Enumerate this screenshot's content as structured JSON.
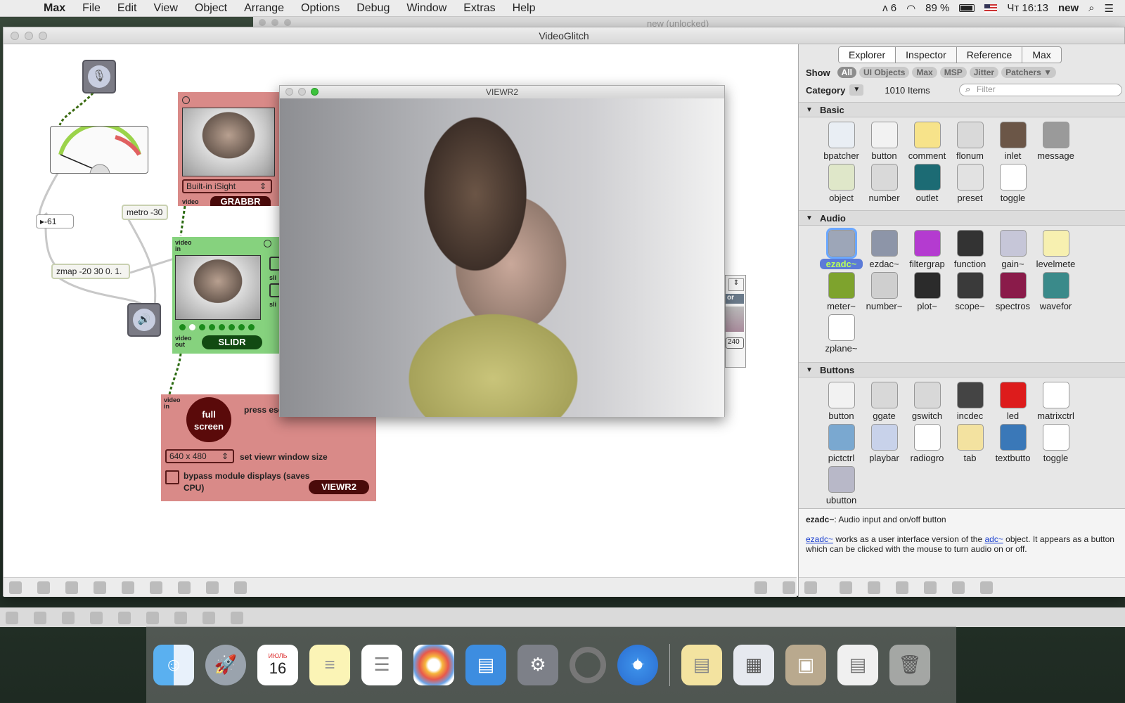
{
  "menubar": {
    "apple": "",
    "items": [
      "Max",
      "File",
      "Edit",
      "View",
      "Object",
      "Arrange",
      "Options",
      "Debug",
      "Window",
      "Extras",
      "Help"
    ],
    "status_input": "6",
    "battery": "89 %",
    "clock": "Чт 16:13",
    "user": "new"
  },
  "back_window": {
    "title": "new (unlocked)"
  },
  "main_window": {
    "title": "VideoGlitch"
  },
  "patcher": {
    "number_box": "-61",
    "metro": "metro -30",
    "zmap": "zmap -20 30 0. 1.",
    "grabbr": {
      "camera": "Built-in iSight",
      "tag": "video",
      "name": "GRABBR"
    },
    "slidr": {
      "in_tag": "video in",
      "out_tag": "video out",
      "name": "SLIDR",
      "slider1": "sli",
      "slider2": "sli"
    },
    "viewr": {
      "in_tag": "video in",
      "fullscreen_button": "full screen",
      "esc_note": "press esc to exit fullscreen",
      "size_value": "640 x 480",
      "size_label": "set viewr window size",
      "bypass_label": "bypass module displays (saves CPU)",
      "name": "VIEWR2"
    },
    "hidden_module": {
      "tag": "or",
      "value": "240"
    }
  },
  "viewr_window": {
    "title": "VIEWR2"
  },
  "panel": {
    "tabs": [
      "Explorer",
      "Inspector",
      "Reference",
      "Max"
    ],
    "show_label": "Show",
    "filters": [
      "All",
      "UI Objects",
      "Max",
      "MSP",
      "Jitter",
      "Patchers ▼"
    ],
    "category_label": "Category",
    "item_count": "1010 Items",
    "filter_placeholder": "Filter",
    "sections": {
      "basic": {
        "title": "Basic",
        "items": [
          {
            "label": "bpatcher",
            "icon": "bpatcher-icon",
            "color": "#e9eef4"
          },
          {
            "label": "button",
            "icon": "button-icon",
            "color": "#f2f2f2"
          },
          {
            "label": "comment",
            "icon": "comment-icon",
            "color": "#f7e38a"
          },
          {
            "label": "flonum",
            "icon": "flonum-icon",
            "color": "#d9d9d9"
          },
          {
            "label": "inlet",
            "icon": "inlet-icon",
            "color": "#6b5647"
          },
          {
            "label": "message",
            "icon": "message-icon",
            "color": "#9a9a9a"
          },
          {
            "label": "object",
            "icon": "object-icon",
            "color": "#dfe7c9"
          },
          {
            "label": "number",
            "icon": "number-icon",
            "color": "#d9d9d9"
          },
          {
            "label": "outlet",
            "icon": "outlet-icon",
            "color": "#1c6b74"
          },
          {
            "label": "preset",
            "icon": "preset-icon",
            "color": "#e2e2e2"
          },
          {
            "label": "toggle",
            "icon": "toggle-icon",
            "color": "#ffffff"
          }
        ]
      },
      "audio": {
        "title": "Audio",
        "items": [
          {
            "label": "ezadc~",
            "icon": "microphone-icon",
            "color": "#9da6b8"
          },
          {
            "label": "ezdac~",
            "icon": "speaker-icon",
            "color": "#8d95a8"
          },
          {
            "label": "filtergrap",
            "icon": "filtergraph-icon",
            "color": "#b43bd0"
          },
          {
            "label": "function",
            "icon": "function-icon",
            "color": "#333333"
          },
          {
            "label": "gain~",
            "icon": "gain-icon",
            "color": "#c6c6d8"
          },
          {
            "label": "levelmete",
            "icon": "levelmeter-icon",
            "color": "#f7f0b0"
          },
          {
            "label": "meter~",
            "icon": "meter-icon",
            "color": "#7ea32d"
          },
          {
            "label": "number~",
            "icon": "number-tilde-icon",
            "color": "#cfcfcf"
          },
          {
            "label": "plot~",
            "icon": "plot-icon",
            "color": "#2b2b2b"
          },
          {
            "label": "scope~",
            "icon": "scope-icon",
            "color": "#3a3a3a"
          },
          {
            "label": "spectros",
            "icon": "spectroscope-icon",
            "color": "#8a1b4a"
          },
          {
            "label": "wavefor",
            "icon": "waveform-icon",
            "color": "#3a8a8a"
          },
          {
            "label": "zplane~",
            "icon": "zplane-icon",
            "color": "#ffffff"
          }
        ]
      },
      "buttons": {
        "title": "Buttons",
        "items": [
          {
            "label": "button",
            "icon": "button-icon",
            "color": "#f2f2f2"
          },
          {
            "label": "ggate",
            "icon": "ggate-icon",
            "color": "#d8d8d8"
          },
          {
            "label": "gswitch",
            "icon": "gswitch-icon",
            "color": "#d8d8d8"
          },
          {
            "label": "incdec",
            "icon": "incdec-icon",
            "color": "#444444"
          },
          {
            "label": "led",
            "icon": "led-icon",
            "color": "#dd1c1c"
          },
          {
            "label": "matrixctrl",
            "icon": "matrixctrl-icon",
            "color": "#ffffff"
          },
          {
            "label": "pictctrl",
            "icon": "pictctrl-icon",
            "color": "#7aa8d0"
          },
          {
            "label": "playbar",
            "icon": "playbar-icon",
            "color": "#c8d2ea"
          },
          {
            "label": "radiogro",
            "icon": "radiogroup-icon",
            "color": "#ffffff"
          },
          {
            "label": "tab",
            "icon": "tab-icon",
            "color": "#f3e2a0"
          },
          {
            "label": "textbutto",
            "icon": "textbutton-icon",
            "color": "#3a78b8"
          },
          {
            "label": "toggle",
            "icon": "toggle-icon",
            "color": "#ffffff"
          },
          {
            "label": "ubutton",
            "icon": "ubutton-icon",
            "color": "#b8b8c8"
          }
        ]
      }
    },
    "description": {
      "title": "ezadc~",
      "subtitle": ": Audio input and on/off button",
      "link1": "ezadc~",
      "text1": " works as a user interface version of the ",
      "link2": "adc~",
      "text2": " object. It appears as a button which can be clicked with the mouse to turn audio on or off."
    }
  },
  "dock": {
    "calendar_month": "ИЮЛЬ",
    "calendar_day": "16",
    "apps": [
      "finder",
      "launchpad",
      "calendar",
      "notes",
      "reminders",
      "photos",
      "keynote",
      "system-preferences",
      "max",
      "safari",
      "documents",
      "preview-1",
      "preview-2",
      "preview-3",
      "trash"
    ]
  }
}
